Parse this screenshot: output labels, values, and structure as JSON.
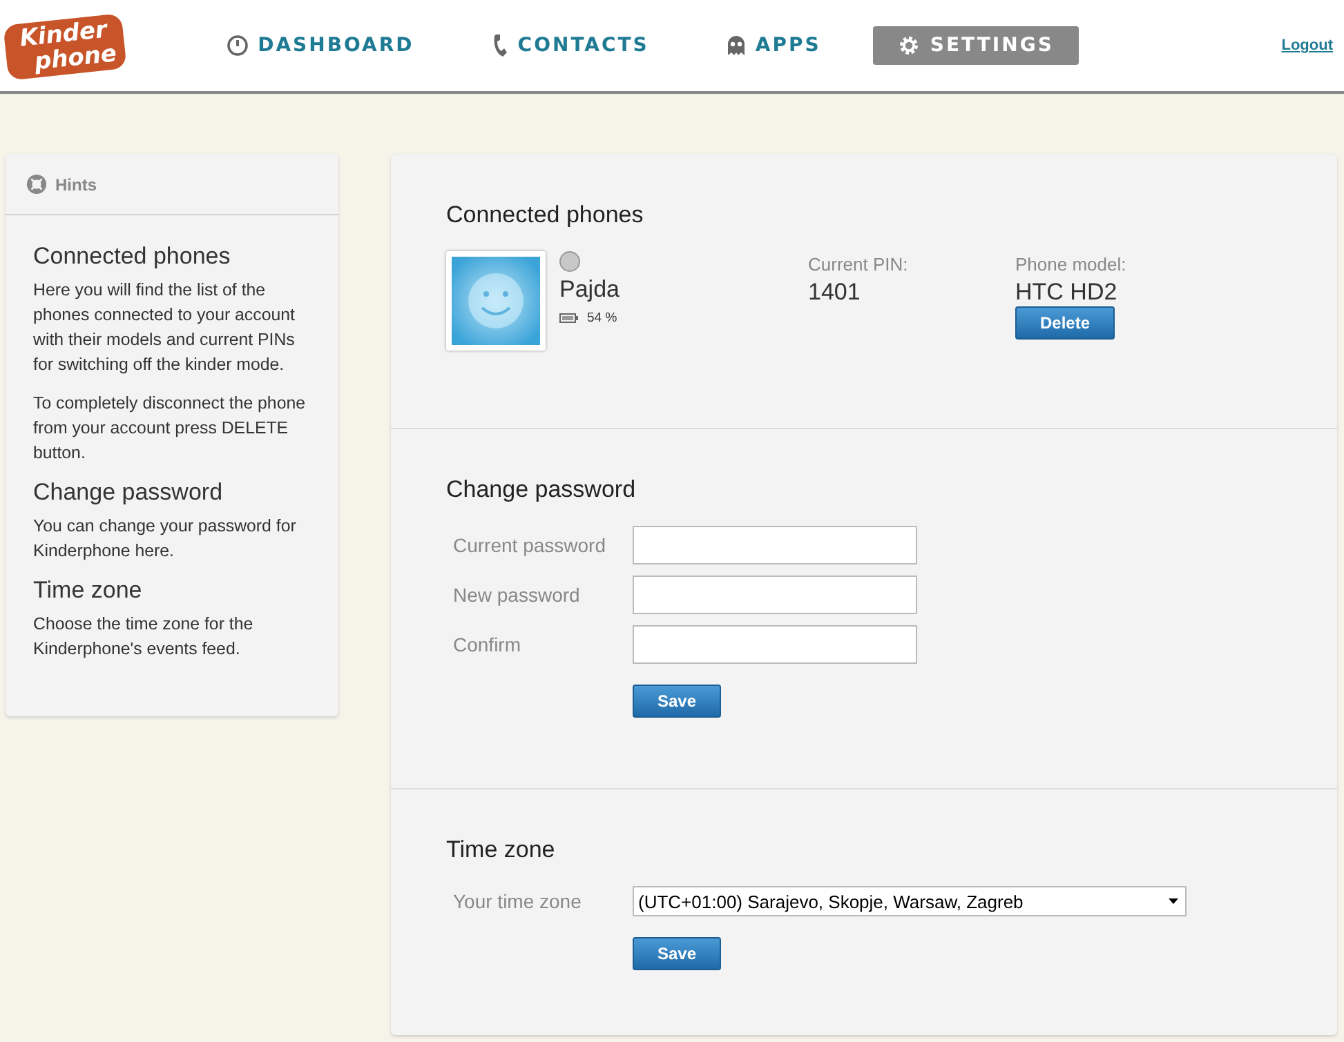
{
  "logo": {
    "line_1": "Kinder",
    "line_2": "phone"
  },
  "nav": [
    {
      "label": "DASHBOARD",
      "selected": false
    },
    {
      "label": "CONTACTS",
      "selected": false
    },
    {
      "label": "APPS",
      "selected": false
    },
    {
      "label": "SETTINGS",
      "selected": true
    }
  ],
  "logout": "Logout",
  "hints": {
    "title": "Hints",
    "sections": [
      {
        "heading": "Connected phones",
        "paragraphs": [
          "Here you will find the list of the phones connected to your account with their models and current PINs for switching off the kinder mode.",
          "To completely disconnect the phone from your account press DELETE button."
        ]
      },
      {
        "heading": "Change password",
        "paragraphs": [
          "You can change your password for Kinderphone here."
        ]
      },
      {
        "heading": "Time zone",
        "paragraphs": [
          "Choose the time zone for the Kinderphone's events feed."
        ]
      }
    ]
  },
  "phones": {
    "title": "Connected phones",
    "items": [
      {
        "name": "Pajda",
        "online": false,
        "battery": "54 %",
        "pin_label": "Current PIN:",
        "pin": "1401",
        "model_label": "Phone model:",
        "model": "HTC HD2",
        "button": "Delete"
      }
    ]
  },
  "password": {
    "title": "Change password",
    "fields": [
      {
        "label": "Current password"
      },
      {
        "label": "New password"
      },
      {
        "label": "Confirm"
      }
    ],
    "button": "Save"
  },
  "timezone": {
    "title": "Time zone",
    "label": "Your time zone",
    "value": "(UTC+01:00) Sarajevo, Skopje, Warsaw, Zagreb",
    "button": "Save"
  }
}
